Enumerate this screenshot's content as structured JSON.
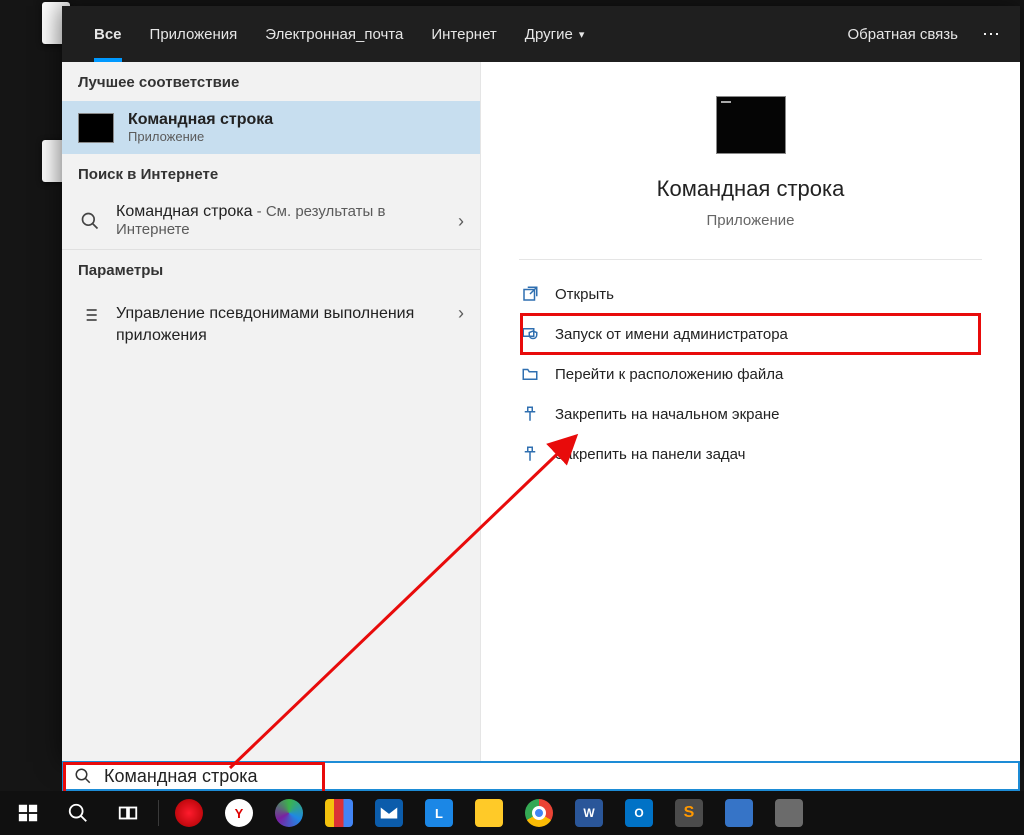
{
  "tabs": {
    "all": "Все",
    "apps": "Приложения",
    "email": "Электронная_почта",
    "internet": "Интернет",
    "others": "Другие",
    "feedback": "Обратная связь"
  },
  "left": {
    "best_match": "Лучшее соответствие",
    "item": {
      "title": "Командная строка",
      "sub": "Приложение"
    },
    "web_hdr": "Поиск в Интернете",
    "web": {
      "title": "Командная строка",
      "sub": " - См. результаты в Интернете"
    },
    "settings_hdr": "Параметры",
    "settings_item": "Управление псевдонимами выполнения приложения"
  },
  "right": {
    "title": "Командная строка",
    "sub": "Приложение",
    "actions": {
      "open": "Открыть",
      "admin": "Запуск от имени администратора",
      "location": "Перейти к расположению файла",
      "pin_start": "Закрепить на начальном экране",
      "pin_task": "Закрепить на панели задач"
    }
  },
  "search": {
    "value": "Командная строка"
  }
}
